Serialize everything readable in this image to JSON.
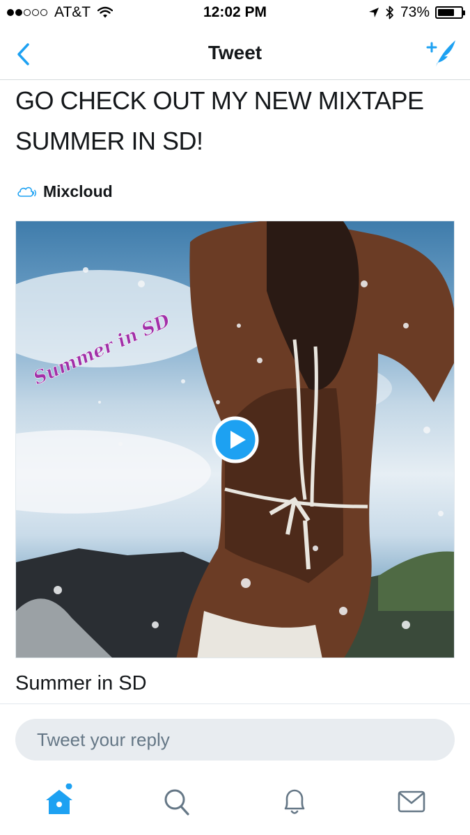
{
  "status_bar": {
    "signal_dots": [
      true,
      true,
      false,
      false,
      false
    ],
    "carrier": "AT&T",
    "time": "12:02 PM",
    "battery_text": "73%",
    "battery_level": 0.73,
    "icons": [
      "wifi-icon",
      "location-arrow-icon",
      "bluetooth-icon",
      "battery-icon"
    ]
  },
  "nav": {
    "title": "Tweet",
    "back_icon": "chevron-left-icon",
    "compose_icon": "compose-tweet-icon",
    "accent_color": "#1da1f2"
  },
  "tweet": {
    "text": "GO CHECK OUT MY NEW MIXTAPE\nSUMMER IN SD!",
    "card": {
      "source_icon": "cloud-icon",
      "source": "Mixcloud",
      "image_overlay_text": "Summer in SD",
      "play_icon": "play-icon",
      "title": "Summer in SD"
    }
  },
  "reply": {
    "placeholder": "Tweet your reply"
  },
  "tab_bar": {
    "tabs": [
      {
        "name": "home",
        "icon": "home-icon",
        "active": true,
        "has_notification_dot": true
      },
      {
        "name": "search",
        "icon": "search-icon",
        "active": false
      },
      {
        "name": "notifications",
        "icon": "bell-icon",
        "active": false
      },
      {
        "name": "messages",
        "icon": "envelope-icon",
        "active": false
      }
    ],
    "active_color": "#1da1f2",
    "inactive_color": "#657786"
  }
}
